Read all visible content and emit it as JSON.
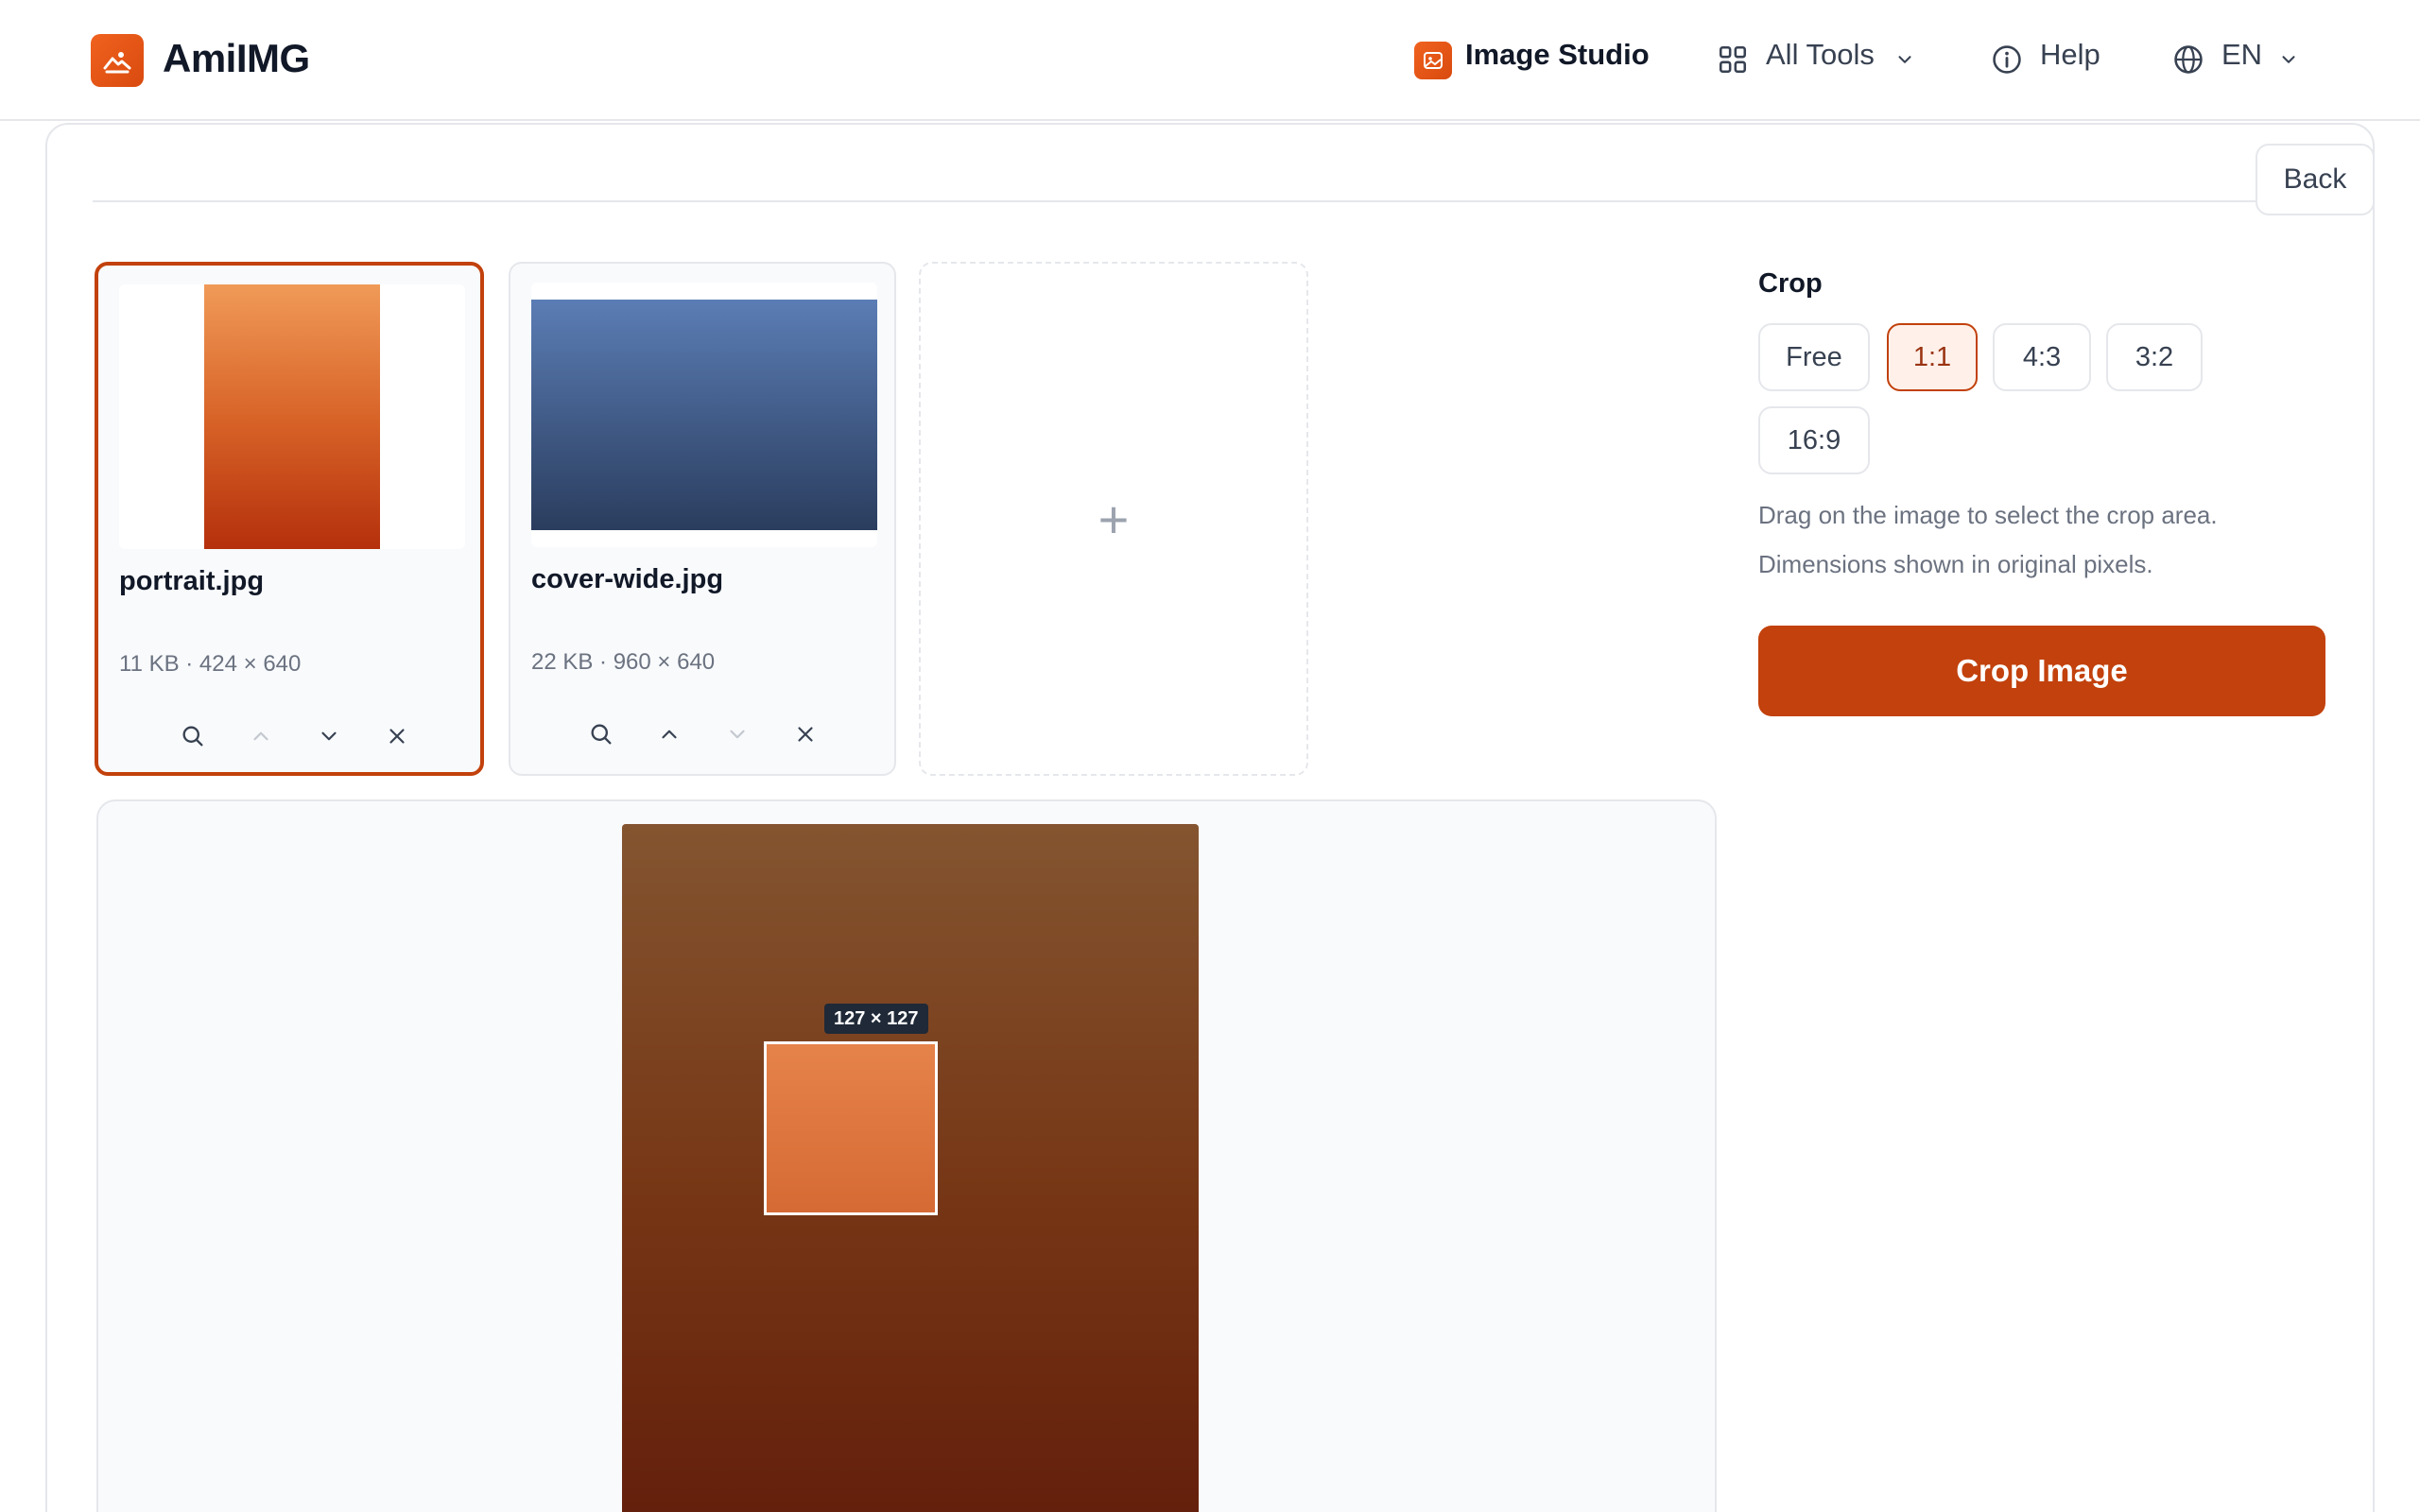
{
  "header": {
    "logo_text": "AmiIMG",
    "nav": {
      "studio": "Image Studio",
      "all_tools": "All Tools",
      "help": "Help",
      "language": "EN"
    }
  },
  "toolbar": {
    "back_label": "Back"
  },
  "files": [
    {
      "name": "portrait.jpg",
      "meta": "11 KB · 424 × 640",
      "selected": true,
      "colors": [
        "#f09a58",
        "#b5300c"
      ]
    },
    {
      "name": "cover-wide.jpg",
      "meta": "22 KB · 960 × 640",
      "selected": false,
      "colors": [
        "#5b7db5",
        "#2a3d5e"
      ]
    }
  ],
  "add_card": {
    "symbol": "+"
  },
  "crop_panel": {
    "title": "Crop",
    "ratios": [
      "Free",
      "1:1",
      "4:3",
      "3:2",
      "16:9"
    ],
    "active_ratio": "1:1",
    "hint_line1": "Drag on the image to select the crop area.",
    "hint_line2": "Dimensions shown in original pixels.",
    "action_label": "Crop Image"
  },
  "preview": {
    "selection_label": "127 × 127"
  },
  "colors": {
    "accent": "#c2410c",
    "accent_light": "#fff1ea",
    "border": "#e5e7eb"
  }
}
